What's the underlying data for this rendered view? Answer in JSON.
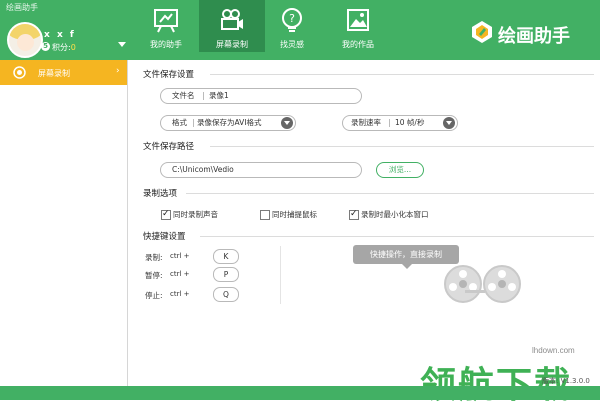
{
  "window": {
    "title": "绘画助手"
  },
  "user": {
    "name": "x x f",
    "level": "5",
    "points_label": "积分:",
    "points_value": "0"
  },
  "nav_tabs": [
    {
      "label": "我的助手",
      "icon": "easel-icon"
    },
    {
      "label": "屏幕录制",
      "icon": "video-camera-icon",
      "active": true
    },
    {
      "label": "找灵感",
      "icon": "lightbulb-question-icon"
    },
    {
      "label": "我的作品",
      "icon": "picture-icon"
    }
  ],
  "brand": {
    "name": "绘画助手",
    "icon": "pencil-logo-icon"
  },
  "sidebar": {
    "items": [
      {
        "label": "屏幕录制",
        "icon": "screen-record-icon",
        "selected": true
      }
    ]
  },
  "file_save": {
    "section_title": "文件保存设置",
    "filename_label": "文件名",
    "filename_value": "录像1",
    "format_label": "格式",
    "format_value": "录像保存为AVI格式",
    "rate_label": "录制速率",
    "rate_value": "10 帧/秒"
  },
  "save_path": {
    "section_title": "文件保存路径",
    "path_value": "C:\\Unicom\\Vedio",
    "browse_label": "浏览..."
  },
  "record_options": {
    "section_title": "录制选项",
    "options": [
      {
        "label": "同时录制声音",
        "checked": true
      },
      {
        "label": "同时捕提鼠标",
        "checked": false
      },
      {
        "label": "录制时最小化本窗口",
        "checked": true
      }
    ]
  },
  "hotkeys": {
    "section_title": "快捷键设置",
    "items": [
      {
        "label": "录制:",
        "modifier": "ctrl +",
        "key": "K"
      },
      {
        "label": "暂停:",
        "modifier": "ctrl +",
        "key": "P"
      },
      {
        "label": "停止:",
        "modifier": "ctrl +",
        "key": "Q"
      }
    ],
    "tooltip": "快捷操作，直接录制",
    "illustration_icon": "film-reel-icon"
  },
  "version": "版本: V1.3.0.0",
  "watermark": {
    "url": "lhdown.com",
    "text": "领航下载"
  },
  "colors": {
    "primary_green": "#42b064",
    "active_tab_green": "#2f8d4e",
    "sidebar_selected": "#f5b521"
  }
}
